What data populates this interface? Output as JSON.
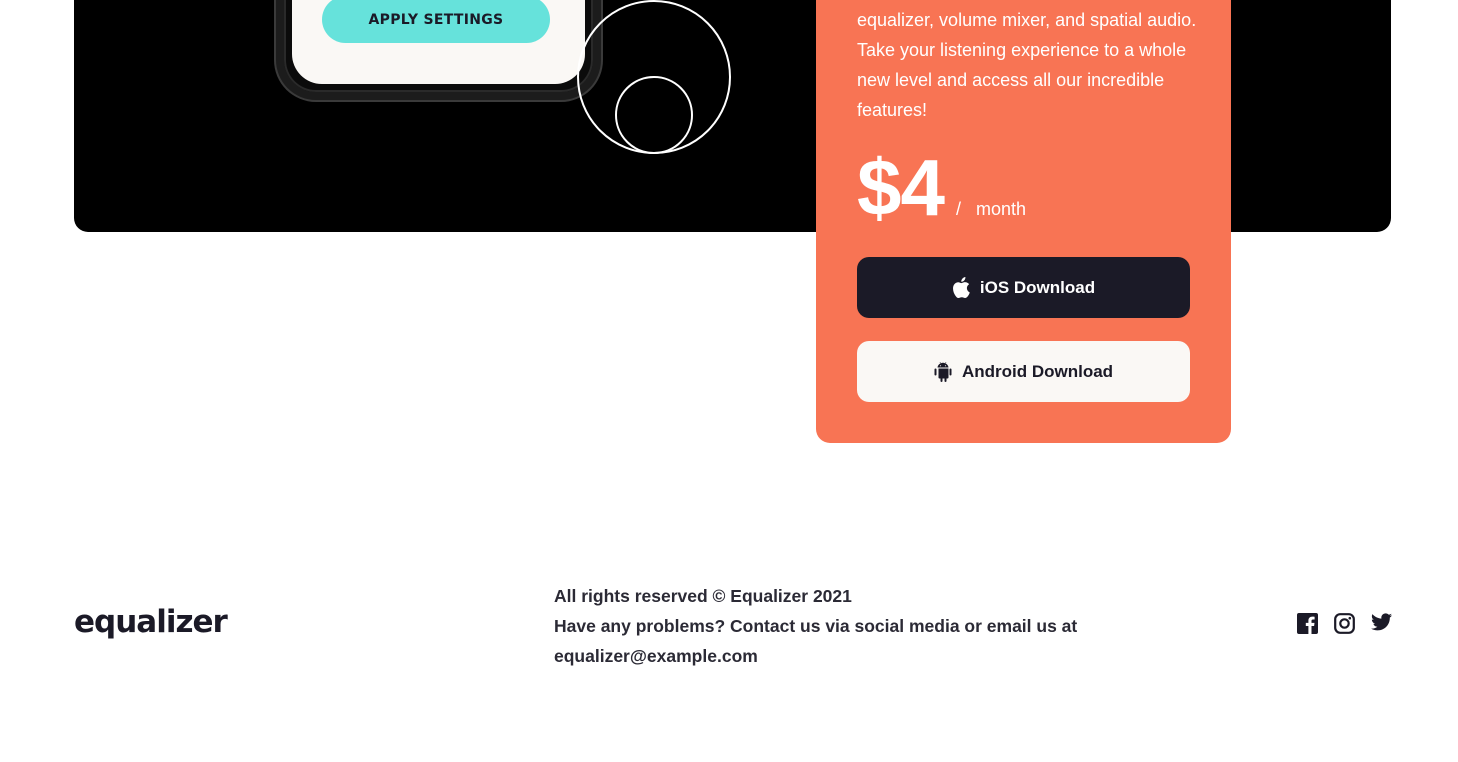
{
  "hero": {
    "apply_button_label": "APPLY SETTINGS"
  },
  "pricing": {
    "description": "equalizer, volume mixer, and spatial audio. Take your listening experience to a whole new level and access all our incredible features!",
    "price": "$4",
    "period_separator": "/",
    "period": "month",
    "ios_button_label": "iOS Download",
    "android_button_label": "Android Download"
  },
  "footer": {
    "logo": "equalizer",
    "copyright": "All rights reserved © Equalizer 2021",
    "contact": "Have any problems? Contact us via social media or email us at equalizer@example.com",
    "social_icons": [
      "facebook-icon",
      "instagram-icon",
      "twitter-icon"
    ]
  },
  "colors": {
    "accent_orange": "#f87454",
    "accent_teal": "#66e2db",
    "dark": "#1b1a27",
    "light": "#faf8f5"
  }
}
